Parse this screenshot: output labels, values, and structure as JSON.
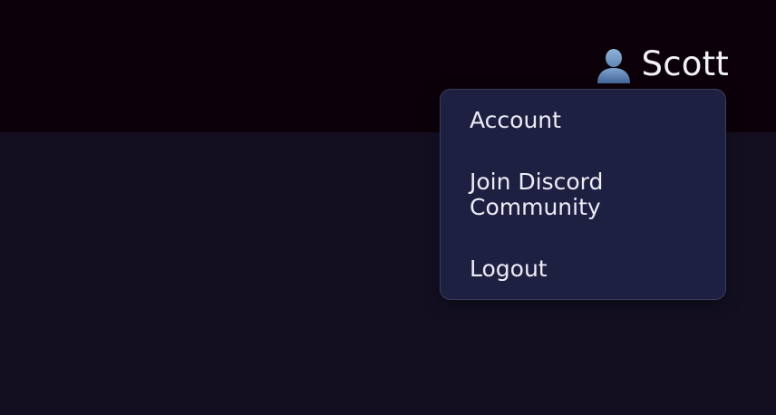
{
  "header": {
    "user_icon": "user-silhouette-icon",
    "user_name": "Scott"
  },
  "user_menu": {
    "items": [
      {
        "label": "Account"
      },
      {
        "label": "Join Discord Community"
      },
      {
        "label": "Logout"
      }
    ]
  },
  "colors": {
    "header_bg": "#0c0109",
    "page_bg": "#130f21",
    "menu_bg": "#1e2042",
    "menu_border": "#3b3d5d",
    "text": "#eeecf6"
  }
}
